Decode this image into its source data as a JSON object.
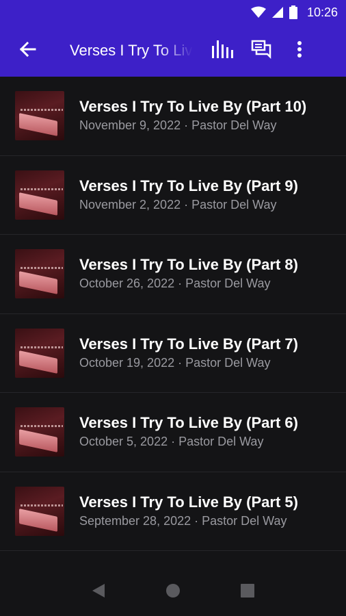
{
  "status_bar": {
    "time": "10:26",
    "icons": [
      "wifi-icon",
      "cell-signal-icon",
      "battery-icon"
    ]
  },
  "app_bar": {
    "title": "Verses I Try To Live By",
    "back_icon": "arrow-back-icon",
    "actions": [
      "equalizer-icon",
      "chat-icon",
      "more-vert-icon"
    ]
  },
  "colors": {
    "app_bar": "#3d20c8",
    "background": "#141416",
    "title_text": "#ffffff",
    "subtitle_text": "#9a9aa0"
  },
  "episodes": [
    {
      "title": "Verses I Try To Live By (Part 10)",
      "subtitle": "November 9, 2022 · Pastor Del Way"
    },
    {
      "title": "Verses I Try To Live By (Part 9)",
      "subtitle": "November 2, 2022 · Pastor Del Way"
    },
    {
      "title": "Verses I Try To Live By (Part 8)",
      "subtitle": "October 26, 2022 · Pastor Del Way"
    },
    {
      "title": "Verses I Try To Live By (Part 7)",
      "subtitle": "October 19, 2022 · Pastor Del Way"
    },
    {
      "title": "Verses I Try To Live By (Part 6)",
      "subtitle": "October 5, 2022 · Pastor Del Way"
    },
    {
      "title": "Verses I Try To Live By (Part 5)",
      "subtitle": "September 28, 2022 · Pastor Del Way"
    }
  ],
  "nav_bar": [
    "nav-back-icon",
    "nav-home-icon",
    "nav-recents-icon"
  ]
}
